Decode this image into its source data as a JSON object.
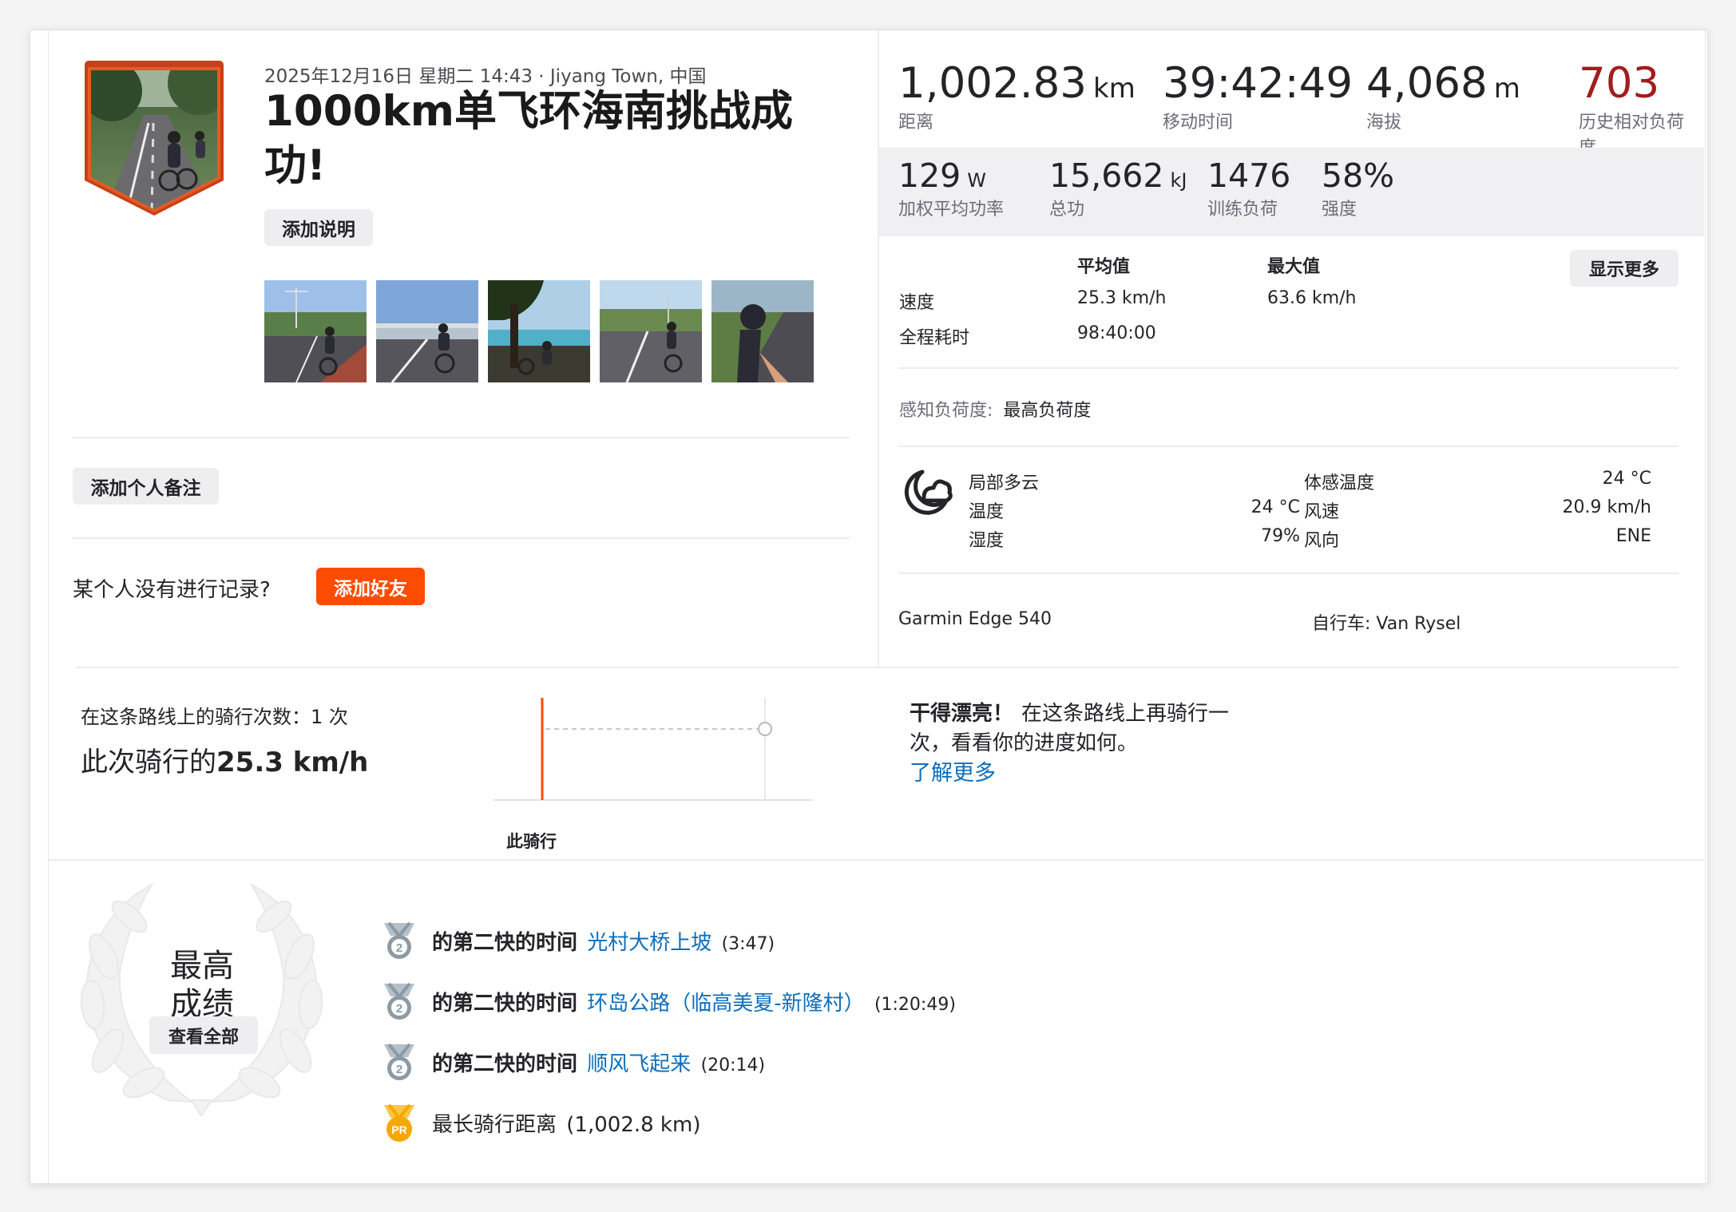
{
  "activity": {
    "datetime_location": "2025年12月16日 星期二 14:43 · Jiyang Town, 中国",
    "title_line1": "1000km单飞环海南挑战成",
    "title_line2": "功!",
    "add_description": "添加说明"
  },
  "left": {
    "add_private_note": "添加个人备注",
    "missing_prompt": "某个人没有进行记录?",
    "add_friend": "添加好友"
  },
  "stats_primary": [
    {
      "value": "1,002.83",
      "unit": "km",
      "label": "距离",
      "color": "#242428"
    },
    {
      "value": "39:42:49",
      "unit": "",
      "label": "移动时间",
      "color": "#242428"
    },
    {
      "value": "4,068",
      "unit": "m",
      "label": "海拔",
      "color": "#242428"
    },
    {
      "value": "703",
      "unit": "",
      "label": "历史相对负荷度",
      "color": "#a31c1c"
    }
  ],
  "stats_secondary": [
    {
      "value": "129",
      "unit": "W",
      "label": "加权平均功率"
    },
    {
      "value": "15,662",
      "unit": "kJ",
      "label": "总功"
    },
    {
      "value": "1476",
      "unit": "",
      "label": "训练负荷"
    },
    {
      "value": "58%",
      "unit": "",
      "label": "强度"
    }
  ],
  "table": {
    "avg_header": "平均值",
    "max_header": "最大值",
    "show_more": "显示更多",
    "rows": [
      {
        "label": "速度",
        "avg": "25.3 km/h",
        "max": "63.6 km/h"
      },
      {
        "label": "全程耗时",
        "avg": "98:40:00",
        "max": ""
      }
    ]
  },
  "perceived": {
    "label": "感知负荷度:",
    "value": "最高负荷度"
  },
  "weather": {
    "condition": "局部多云",
    "temp_label": "温度",
    "temp": "24 °C",
    "humidity_label": "湿度",
    "humidity": "79%",
    "feels_label": "体感温度",
    "feels": "24 °C",
    "wind_speed_label": "风速",
    "wind_speed": "20.9 km/h",
    "wind_dir_label": "风向",
    "wind_dir": "ENE"
  },
  "device": {
    "device": "Garmin Edge 540",
    "bike": "自行车: Van Rysel"
  },
  "route": {
    "count_label": "在这条路线上的骑行次数：1 次",
    "speed_prefix": "此次骑行的",
    "speed_value": "25.3 km/h",
    "chart_label": "此骑行",
    "msg_bold": "干得漂亮！",
    "msg_line1": "在这条路线上再骑行一",
    "msg_line2": "次，看看你的进度如何。",
    "learn_more": "了解更多"
  },
  "achievements": {
    "title_line1": "最高",
    "title_line2": "成绩",
    "view_all": "查看全部",
    "items": [
      {
        "badge": "2",
        "prefix": "的第二快的时间",
        "segment": "光村大桥上坡",
        "time": "(3:47)"
      },
      {
        "badge": "2",
        "prefix": "的第二快的时间",
        "segment": "环岛公路（临高美夏-新隆村）",
        "time": "(1:20:49)"
      },
      {
        "badge": "2",
        "prefix": "的第二快的时间",
        "segment": "顺风飞起来",
        "time": "(20:14)"
      },
      {
        "badge": "PR",
        "prefix": "最长骑行距离",
        "segment": "",
        "time": "(1,002.8 km)"
      }
    ]
  },
  "colors": {
    "accent": "#fc4c02",
    "relative_effort": "#a31c1c",
    "link": "#0d6ebc",
    "medal_silver": "#8c9aa4",
    "pr_gold": "#f5a800"
  }
}
